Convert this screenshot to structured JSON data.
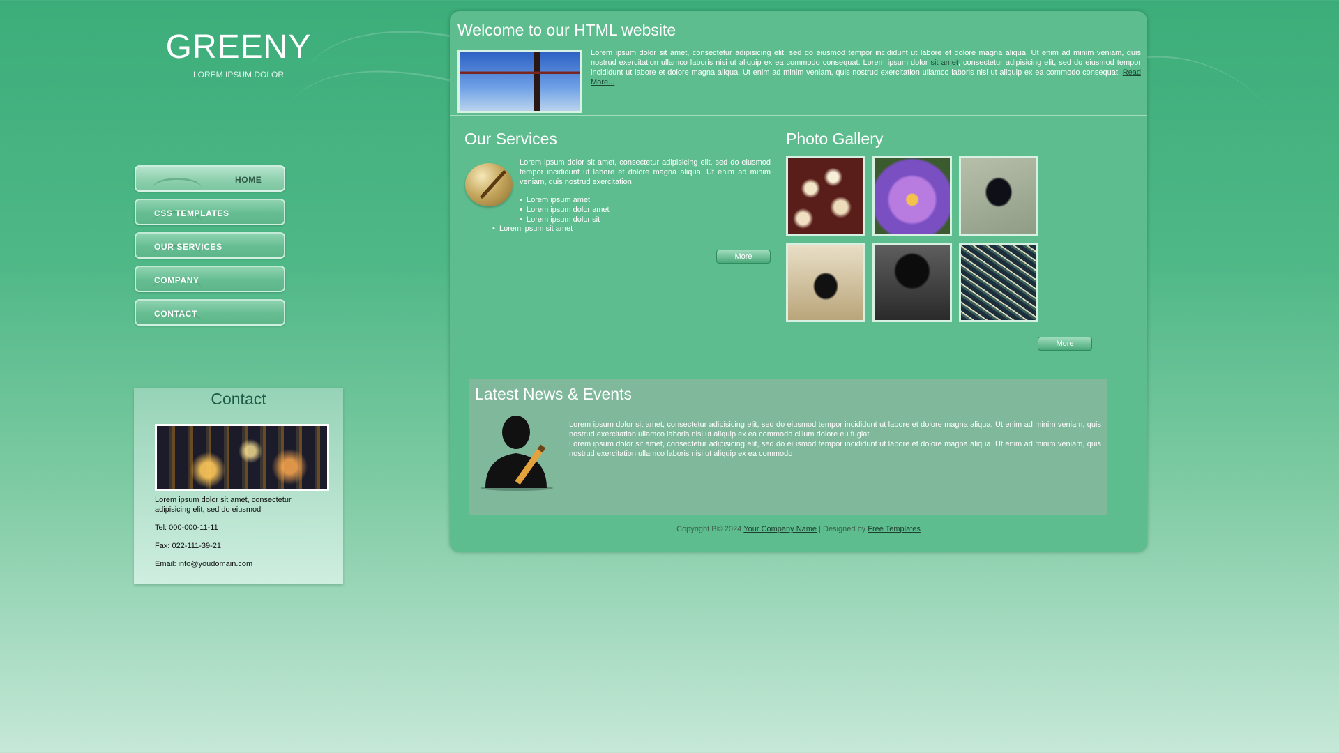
{
  "brand": {
    "title": "GREENY",
    "tagline": "LOREM IPSUM DOLOR"
  },
  "nav": {
    "items": [
      {
        "label": "HOME"
      },
      {
        "label": "CSS TEMPLATES"
      },
      {
        "label": "OUR SERVICES"
      },
      {
        "label": "COMPANY"
      },
      {
        "label": "CONTACT"
      }
    ]
  },
  "contact": {
    "title": "Contact",
    "description": "Lorem ipsum dolor sit amet, consectetur adipisicing elit, sed do eiusmod",
    "tel": "Tel: 000-000-11-11",
    "fax": "Fax: 022-111-39-21",
    "email": "Email: info@youdomain.com"
  },
  "welcome": {
    "title": "Welcome to our HTML website",
    "text_1": "Lorem ipsum dolor sit amet, consectetur adipisicing elit, sed do eiusmod tempor incididunt ut labore et dolore magna aliqua. Ut enim ad minim veniam, quis nostrud exercitation ullamco laboris nisi ut aliquip ex ea commodo consequat. Lorem ipsum dolor ",
    "link_sit_amet": "sit amet",
    "text_2": ", consectetur adipisicing elit, sed do eiusmod tempor incididunt ut labore et dolore magna aliqua. Ut enim ad minim veniam, quis nostrud exercitation ullamco laboris nisi ut aliquip ex ea commodo consequat. ",
    "read_more": "Read More..."
  },
  "services": {
    "title": "Our Services",
    "text": "Lorem ipsum dolor sit amet, consectetur adipisicing elit, sed do eiusmod tempor incididunt ut labore et dolore magna aliqua. Ut enim ad minim veniam, quis nostrud exercitation",
    "list": [
      "Lorem ipsum amet",
      "Lorem ipsum dolor amet",
      "Lorem ipsum dolor sit"
    ],
    "extra": "Lorem ipsum sit amet",
    "more": "More"
  },
  "gallery": {
    "title": "Photo Gallery",
    "more": "More"
  },
  "news": {
    "title": "Latest News & Events",
    "text_1": "Lorem ipsum dolor sit amet, consectetur adipisicing elit, sed do eiusmod tempor incididunt ut labore et dolore magna aliqua. Ut enim ad minim veniam, quis nostrud exercitation ullamco laboris nisi ut aliquip ex ea commodo cillum dolore eu fugiat",
    "text_2": "Lorem ipsum dolor sit amet, consectetur adipisicing elit, sed do eiusmod tempor incididunt ut labore et dolore magna aliqua. Ut enim ad minim veniam, quis nostrud exercitation ullamco laboris nisi ut aliquip ex ea commodo"
  },
  "footer": {
    "copyright": "Copyright В© 2024 ",
    "company_link": "Your Company Name",
    "designed_by": " | Designed by ",
    "designer_link": "Free Templates"
  }
}
